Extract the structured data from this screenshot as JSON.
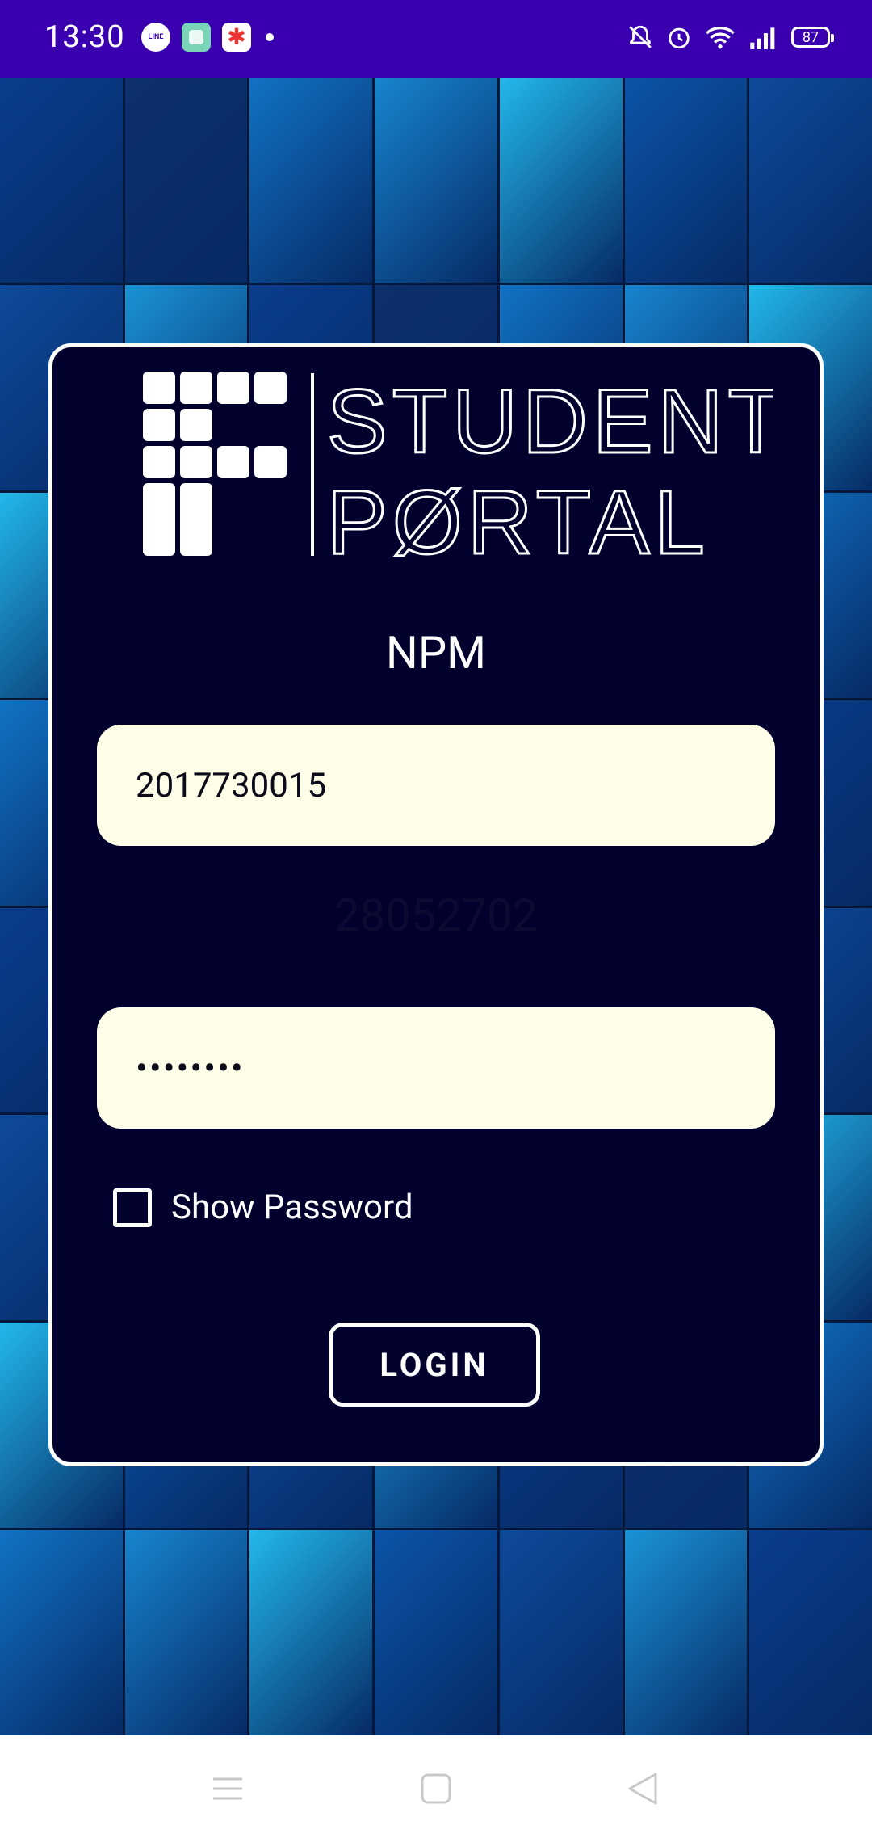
{
  "status_bar": {
    "time": "13:30",
    "notifications": [
      "line-icon",
      "app-icon",
      "star-app-icon",
      "dot-icon"
    ],
    "system_icons": [
      "bell-muted-icon",
      "alarm-icon",
      "wifi-icon",
      "signal-icon",
      "battery-icon"
    ],
    "battery_level": "87",
    "color": "#3a00b0"
  },
  "login_card": {
    "logo_text_line1": "STUDENT",
    "logo_text_line2": "PØRTAL",
    "npm_label": "NPM",
    "npm_value": "2017730015",
    "password_hint": "28052702",
    "password_value": "••••••••",
    "show_password_label": "Show Password",
    "show_password_checked": false,
    "login_button": "LOGIN",
    "card_color": "#02012e",
    "field_color": "#fefde8"
  },
  "nav_bar": {
    "buttons": [
      "menu-icon",
      "home-icon",
      "back-icon"
    ]
  }
}
